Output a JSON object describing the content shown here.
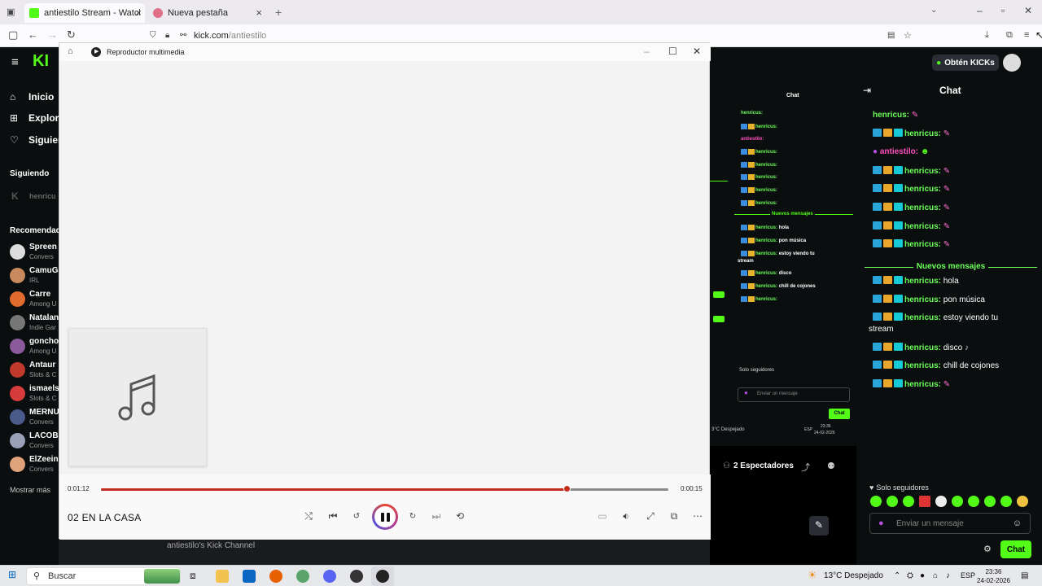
{
  "browser": {
    "tabs": [
      {
        "title": "antiestilo Stream - Watch Live o"
      },
      {
        "title": "Nueva pestaña"
      }
    ],
    "url_host": "kick.com",
    "url_path": "/antiestilo"
  },
  "kick": {
    "nav": [
      "Inicio",
      "Explora",
      "Siguien"
    ],
    "following_label": "Siguiendo",
    "following_user": "henricu",
    "recommended_label": "Recomendad",
    "channels": [
      {
        "name": "Spreen",
        "sub": "Convers"
      },
      {
        "name": "CamuGa",
        "sub": "IRL"
      },
      {
        "name": "Carre",
        "sub": "Among U"
      },
      {
        "name": "Natalan",
        "sub": "Indie Gar"
      },
      {
        "name": "goncho",
        "sub": "Among U"
      },
      {
        "name": "Antaur",
        "sub": "Slots & C"
      },
      {
        "name": "ismaels",
        "sub": "Slots & C"
      },
      {
        "name": "MERNU",
        "sub": "Convers"
      },
      {
        "name": "LACOBR",
        "sub": "Convers"
      },
      {
        "name": "ElZeein",
        "sub": "Convers"
      }
    ],
    "show_more": "Mostrar más",
    "channel_footer": "antiestilo's Kick Channel",
    "kicks_button": "Obtén KICKs"
  },
  "inner_chat": {
    "title": "Chat",
    "new_messages": "Nuevos mensajes",
    "only_followers": "Solo seguidores",
    "input_placeholder": "Enviar un mensaje",
    "chat_button": "Chat",
    "weather": "3°C Despejado",
    "time": "23:36",
    "date": "24-02-2026",
    "lang": "ESP"
  },
  "chat": {
    "title": "Chat",
    "messages_before": [
      {
        "user": "henricus:",
        "text": "",
        "badges": false
      },
      {
        "user": "henricus:",
        "text": "",
        "badges": true
      },
      {
        "user": "antiestilo:",
        "text": "",
        "badges": false,
        "streamer": true
      },
      {
        "user": "henricus:",
        "text": "",
        "badges": true
      },
      {
        "user": "henricus:",
        "text": "",
        "badges": true
      },
      {
        "user": "henricus:",
        "text": "",
        "badges": true
      },
      {
        "user": "henricus:",
        "text": "",
        "badges": true
      },
      {
        "user": "henricus:",
        "text": "",
        "badges": true
      }
    ],
    "new_messages": "Nuevos mensajes",
    "messages_after": [
      {
        "user": "henricus:",
        "text": "hola"
      },
      {
        "user": "henricus:",
        "text": "pon música"
      },
      {
        "user": "henricus:",
        "text": "estoy viendo tu"
      },
      {
        "user": "henricus:",
        "text": "disco"
      },
      {
        "user": "henricus:",
        "text": "chill de cojones"
      },
      {
        "user": "henricus:",
        "text": ""
      }
    ],
    "wrap_text": "stream",
    "spectators": "2 Espectadores",
    "only_followers": "Solo seguidores",
    "input_placeholder": "Enviar un mensaje",
    "chat_button": "Chat"
  },
  "player": {
    "window_title": "Reproductor multimedia",
    "elapsed": "0:01:12",
    "total": "0:00:15",
    "progress_fraction": 0.82,
    "song_title": "02 EN LA CASA",
    "accent": "#c42b1c"
  },
  "taskbar": {
    "search_placeholder": "Buscar",
    "weather": "13°C Despejado",
    "lang": "ESP",
    "time": "23:36",
    "date": "24-02-2026"
  }
}
